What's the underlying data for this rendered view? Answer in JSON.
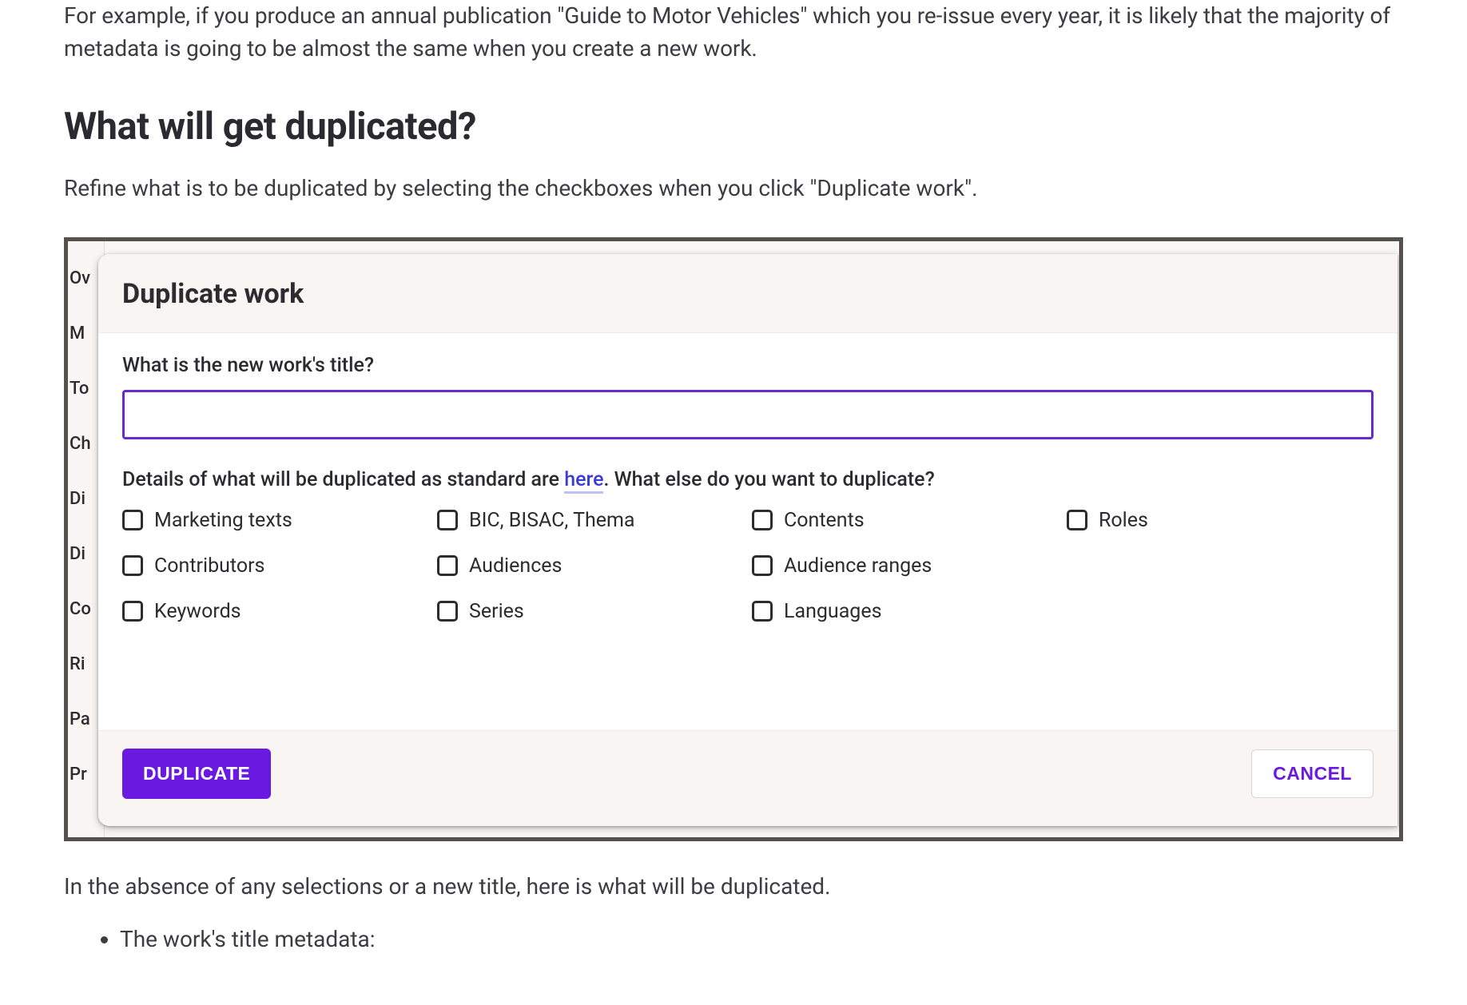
{
  "article": {
    "intro": "For example, if you produce an annual publication \"Guide to Motor Vehicles\" which you re-issue every year, it is likely that the majority of metadata is going to be almost the same when you create a new work.",
    "heading": "What will get duplicated?",
    "body": "Refine what is to be duplicated by selecting the checkboxes when you click \"Duplicate work\".",
    "followup": "In the absence of any selections or a new title, here is what will be duplicated.",
    "bullets": [
      "The work's title metadata:"
    ]
  },
  "bg_sidebar_items": [
    "Ov",
    "M",
    "To",
    "Ch",
    "Di",
    "Di",
    "Co",
    "Ri",
    "Pa",
    "Pr"
  ],
  "modal": {
    "title": "Duplicate work",
    "field_label": "What is the new work's title?",
    "title_value": "",
    "details_prefix": "Details of what will be duplicated as standard are ",
    "details_link": "here",
    "details_suffix": ". What else do you want to duplicate?",
    "options": [
      "Marketing texts",
      "BIC, BISAC, Thema",
      "Contents",
      "Roles",
      "Contributors",
      "Audiences",
      "Audience ranges",
      "",
      "Keywords",
      "Series",
      "Languages",
      ""
    ],
    "primary_label": "DUPLICATE",
    "secondary_label": "CANCEL"
  }
}
